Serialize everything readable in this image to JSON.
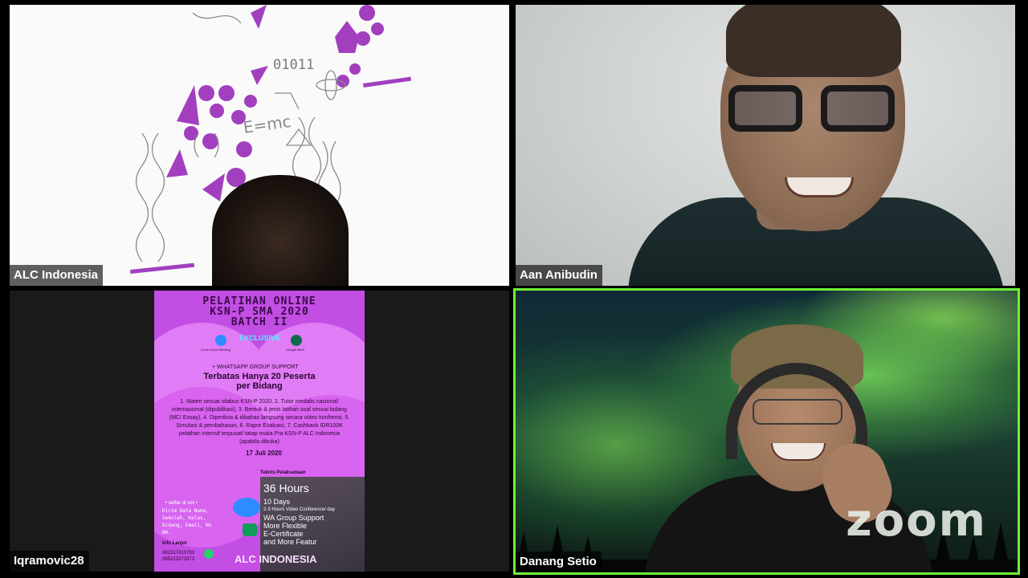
{
  "participants": [
    {
      "name": "ALC Indonesia"
    },
    {
      "name": "Aan Anibudin"
    },
    {
      "name": "Iqramovic28"
    },
    {
      "name": "Danang Setio"
    }
  ],
  "active_speaker_color": "#6ef036",
  "watermark": "zoom",
  "art": {
    "binary": "01011",
    "formula": "E=mc"
  },
  "poster": {
    "title_lines": [
      "PELATIHAN ONLINE",
      "KSN-P SMA 2020",
      "BATCH II"
    ],
    "exclusive": "EXCLUSIVE",
    "zoom_label": "Zoom Cloud Meeting",
    "meet_label": "Google Meet",
    "group_support": "+ WHATSAPP GROUP SUPPORT",
    "headline_lines": [
      "Terbatas Hanya 20 Peserta",
      "per Bidang"
    ],
    "features": "1. Materi sesuai silabus KSN-P 2020, 2. Tutor medalis nasional/ internasional (dipublikasi), 3. Bentuk & jenis latihan soal sesuai bidang (MC/ Essay), 4. Diperiksa & dibahas langsung secara video konfrensi, 5. Simulasi & pembahasan, 6. Rapor Evaluasi, 7. Cashback IDR100K pelathan intensif terpusat/ tatap muka Pra KSN-P ALC Indonesia (apabila dibuka)",
    "date": "17 Juli 2020",
    "teknis": "Teknis Pelaksanaan",
    "hours": "36 Hours",
    "hour_lines": [
      "10 Days",
      "2-3 Hours Video Conference/ day",
      "WA Group Support",
      "More Flexible",
      "E-Certificate",
      "and More Featur"
    ],
    "daftar": "• daftar di sini •",
    "daftar_fields": "Kirim Data Nama, Sekolah, Kelas, Bidang, Email, No WA.",
    "info": "Info Lanjut",
    "phones": [
      "082317410783",
      "085223273373"
    ],
    "brand": "ALC INDONESIA"
  }
}
